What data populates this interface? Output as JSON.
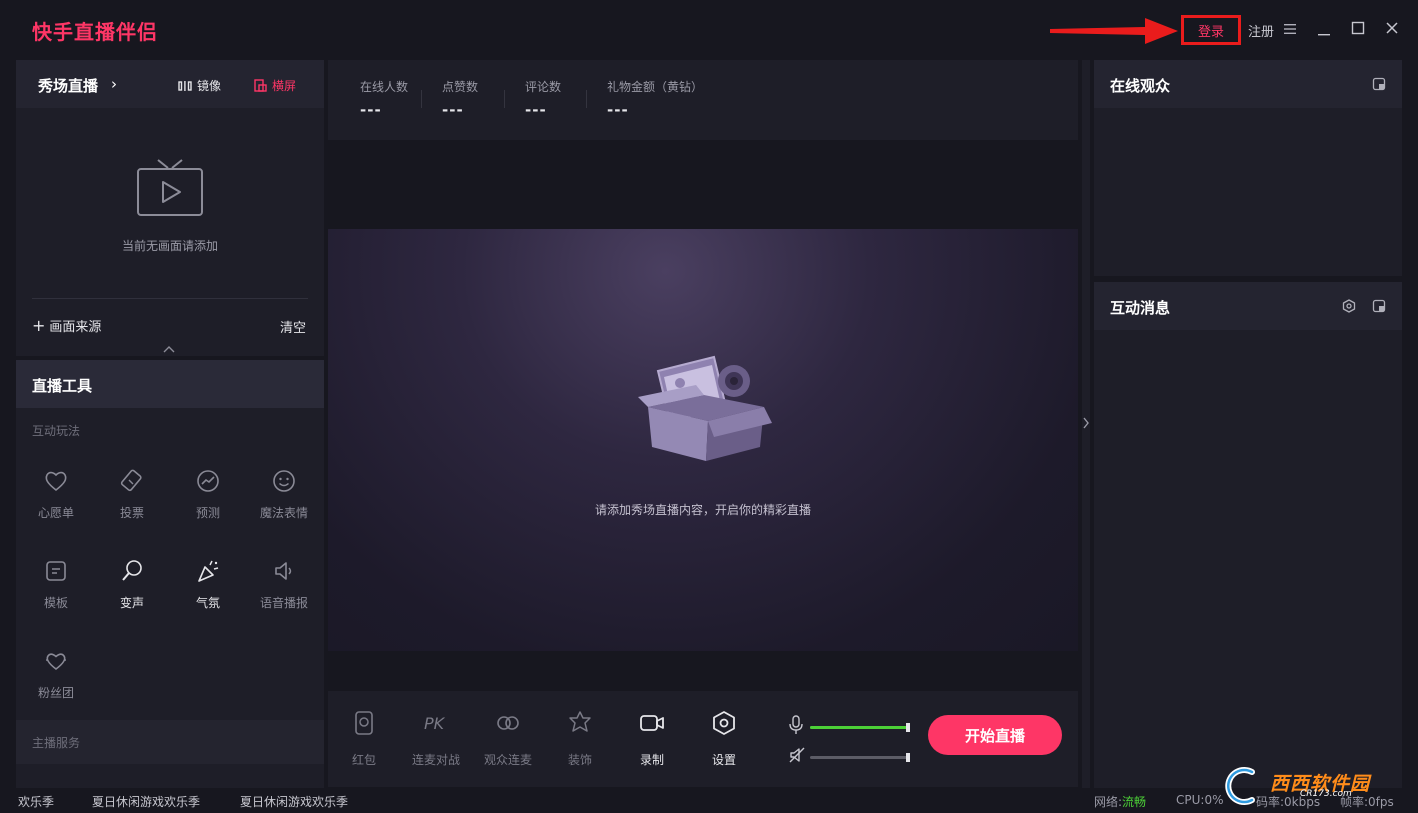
{
  "app": {
    "title": "快手直播伴侣"
  },
  "titlebar": {
    "login": "登录",
    "register": "注册"
  },
  "scene": {
    "title": "秀场直播",
    "mirror": "镜像",
    "landscape": "横屏",
    "empty_text": "当前无画面请添加",
    "add_source": "画面来源",
    "clear": "清空"
  },
  "tools": {
    "title": "直播工具",
    "section_interactive": "互动玩法",
    "items": [
      {
        "label": "心愿单",
        "icon": "heart-icon"
      },
      {
        "label": "投票",
        "icon": "ticket-icon"
      },
      {
        "label": "预测",
        "icon": "trend-icon"
      },
      {
        "label": "魔法表情",
        "icon": "smiley-icon"
      },
      {
        "label": "模板",
        "icon": "template-icon"
      },
      {
        "label": "变声",
        "icon": "voice-changer-icon"
      },
      {
        "label": "气氛",
        "icon": "party-popper-icon"
      },
      {
        "label": "语音播报",
        "icon": "speaker-icon"
      },
      {
        "label": "粉丝团",
        "icon": "fan-club-icon"
      }
    ],
    "section_service": "主播服务"
  },
  "stats": [
    {
      "label": "在线人数",
      "value": "---"
    },
    {
      "label": "点赞数",
      "value": "---"
    },
    {
      "label": "评论数",
      "value": "---"
    },
    {
      "label": "礼物金额（黄钻）",
      "value": "---"
    }
  ],
  "preview": {
    "hint": "请添加秀场直播内容，开启你的精彩直播"
  },
  "bottom_tools": [
    {
      "label": "红包",
      "icon": "red-envelope-icon"
    },
    {
      "label": "连麦对战",
      "icon": "pk-icon"
    },
    {
      "label": "观众连麦",
      "icon": "link-icon"
    },
    {
      "label": "装饰",
      "icon": "decoration-icon"
    },
    {
      "label": "录制",
      "icon": "record-icon"
    },
    {
      "label": "设置",
      "icon": "settings-icon"
    }
  ],
  "audio": {
    "mic_level": 1.0,
    "speaker_level": 1.0,
    "mic_fill_color": "#4cd137"
  },
  "start_button": {
    "label": "开始直播"
  },
  "right": {
    "audience_title": "在线观众",
    "messages_title": "互动消息"
  },
  "footer": {
    "ticker_1": "欢乐季",
    "ticker_2": "夏日休闲游戏欢乐季",
    "ticker_3": "夏日休闲游戏欢乐季",
    "network_label": "网络:",
    "network_value": "流畅",
    "cpu": "CPU:0%",
    "bitrate": "码率:0kbps",
    "framerate": "帧率:0fps"
  },
  "watermark": {
    "text": "西西软件园",
    "sub": "CR173.com"
  },
  "colors": {
    "accent": "#fe3666",
    "background": "#17171f",
    "panel": "#1e1e28",
    "good": "#4cd137"
  }
}
